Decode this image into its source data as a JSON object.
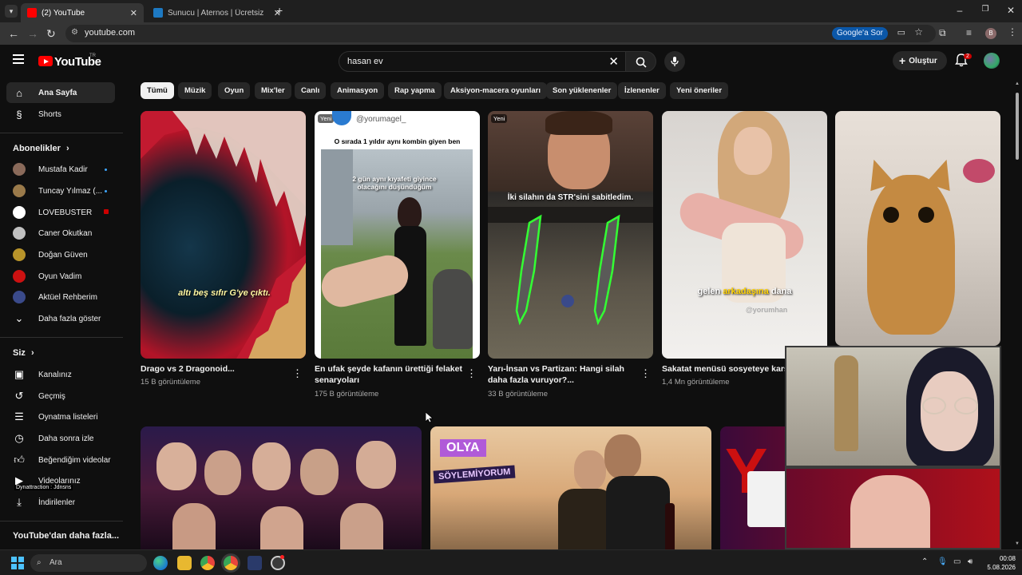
{
  "browser": {
    "tabs": [
      {
        "title": "(2) YouTube",
        "favicon_color": "#ff0000",
        "active": true
      },
      {
        "title": "Sunucu | Aternos | Ücretsiz Min",
        "favicon_color": "#1d79c2",
        "active": false
      }
    ],
    "url": "youtube.com",
    "google_ask": "Google'a Sor",
    "profile_initial": "B"
  },
  "youtube": {
    "logo": "YouTube",
    "logo_sup": "TR",
    "search_value": "hasan ev",
    "create_label": "Oluştur",
    "notification_count": "2"
  },
  "sidebar": {
    "main": [
      {
        "label": "Ana Sayfa",
        "icon": "home-icon",
        "active": true
      },
      {
        "label": "Shorts",
        "icon": "shorts-icon",
        "active": false
      }
    ],
    "subscriptions_header": "Abonelikler",
    "subscriptions": [
      {
        "label": "Mustafa Kadir",
        "color": "#8a6a5a",
        "dot": true
      },
      {
        "label": "Tuncay Yılmaz (...",
        "color": "#9a7a4a",
        "dot": true
      },
      {
        "label": "LOVEBUSTER",
        "color": "#ffffff",
        "dot": false
      },
      {
        "label": "Caner Okutkan",
        "color": "#c0c0c0",
        "dot": false
      },
      {
        "label": "Doğan Güven",
        "color": "#b8942a",
        "dot": false
      },
      {
        "label": "Oyun Vadim",
        "color": "#cc1111",
        "dot": false
      },
      {
        "label": "Aktüel Rehberim",
        "color": "#3a4a8a",
        "dot": false
      }
    ],
    "show_more": "Daha fazla göster",
    "you_header": "Siz",
    "you_items": [
      {
        "label": "Kanalınız",
        "icon": "channel-icon"
      },
      {
        "label": "Geçmiş",
        "icon": "history-icon"
      },
      {
        "label": "Oynatma listeleri",
        "icon": "playlist-icon"
      },
      {
        "label": "Daha sonra izle",
        "icon": "watch-later-icon"
      },
      {
        "label": "Beğendiğim videolar",
        "icon": "like-icon"
      },
      {
        "label": "Videolarınız",
        "icon": "video-icon"
      },
      {
        "label": "İndirilenler",
        "icon": "download-icon"
      }
    ],
    "overlay_text": "Dynattraction : Jdnsns",
    "more_header": "YouTube'dan daha fazla..."
  },
  "chips": [
    "Tümü",
    "Müzik",
    "Oyun",
    "Mix'ler",
    "Canlı",
    "Animasyon",
    "Rap yapma",
    "Aksiyon-macera oyunları",
    "Son yüklenenler",
    "İzlenenler",
    "Yeni öneriler"
  ],
  "videos": [
    {
      "title": "Drago vs 2 Dragonoid...",
      "meta": "15 B görüntüleme",
      "caption": "altı beş sıfır G'ye çıktı.",
      "badge": ""
    },
    {
      "title": "En ufak şeyde kafanın ürettiği felaket senaryoları",
      "meta": "175 B görüntüleme",
      "caption": "O sırada 1 yıldır aynı kombin giyen ben",
      "caption2": "2 gün aynı kıyafeti giyince olacağını düşündüğüm",
      "handle": "@yorumagel_",
      "badge": "Yeni"
    },
    {
      "title": "Yarı-İnsan vs Partizan: Hangi silah daha fazla vuruyor?...",
      "meta": "33 B görüntüleme",
      "caption": "İki silahın da STR'sini sabitledim.",
      "badge": "Yeni"
    },
    {
      "title": "Sakatat menüsü sosyeteye karşı",
      "meta": "1,4 Mn görüntüleme",
      "caption_a": "gelen ",
      "caption_b": "arkadaşına",
      "caption_c": " dana",
      "handle": "@yorumhan",
      "badge": ""
    },
    {
      "title": "",
      "meta": "",
      "badge": ""
    }
  ],
  "row2": {
    "olya": "OLYA",
    "soylemiyorum": "SÖYLEMİYORUM"
  },
  "taskbar": {
    "search": "Ara",
    "time": "00:08",
    "date": "5.08.2026"
  }
}
